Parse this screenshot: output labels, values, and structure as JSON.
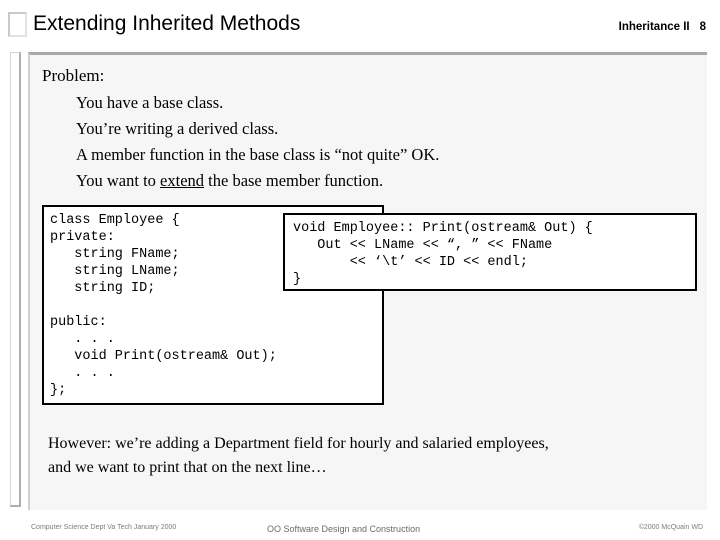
{
  "slide": {
    "title": "Extending Inherited Methods",
    "header_course": "Inheritance II",
    "header_number": "8"
  },
  "body": {
    "problem_heading": "Problem:",
    "bullets": [
      "You have a base class.",
      "You’re writing a derived class.",
      "A member function in the base class is “not quite” OK.",
      "You want to "
    ],
    "bullet3_underlined": "extend",
    "bullet3_tail": " the base member function."
  },
  "code_left": {
    "label": "Employee class declaration",
    "text": "class Employee {\nprivate:\n   string FName;\n   string LName;\n   string ID;\n\npublic:\n   . . .\n   void Print(ostream& Out);\n   . . .\n};"
  },
  "code_right": {
    "label": "Employee Print definition",
    "text": "void Employee:: Print(ostream& Out) {\n   Out << LName << “, ” << FName\n       << ‘\\t’ << ID << endl;\n}"
  },
  "closing": {
    "line1": "However: we’re adding a Department field for hourly and salaried employees,",
    "line2": "and we want to print that on the next line…"
  },
  "footer": {
    "left": "Computer Science Dept Va Tech January 2000",
    "center": "OO Software Design and Construction",
    "right": "©2000  McQuain WD"
  },
  "colors": {
    "panel_background": "#f6f6f6",
    "panel_top_border": "#a9a9a9",
    "code_border": "#000000",
    "footer_text": "#7d7d7d",
    "text": "#000000"
  }
}
